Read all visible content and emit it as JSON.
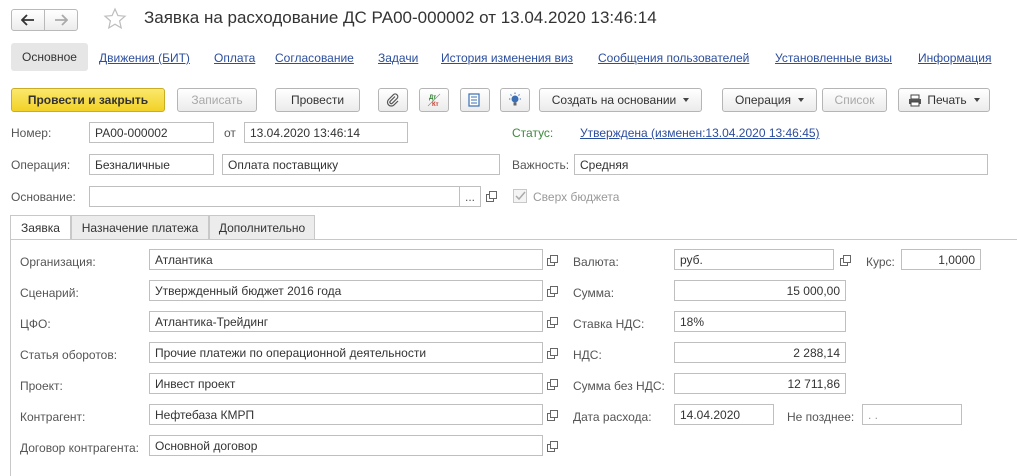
{
  "window": {
    "title": "Заявка на расходование ДС РА00-000002 от 13.04.2020 13:46:14"
  },
  "nav": {
    "back_icon": "arrow-left-icon",
    "forward_icon": "arrow-right-icon",
    "favorite_icon": "star-icon"
  },
  "tabs": [
    {
      "label": "Основное"
    },
    {
      "label": "Движения (БИТ)"
    },
    {
      "label": "Оплата"
    },
    {
      "label": "Согласование"
    },
    {
      "label": "Задачи"
    },
    {
      "label": "История изменения виз"
    },
    {
      "label": "Сообщения пользователей"
    },
    {
      "label": "Установленные визы"
    },
    {
      "label": "Информация"
    }
  ],
  "toolbar": {
    "post_close": "Провести и закрыть",
    "write": "Записать",
    "post": "Провести",
    "create_based_on": "Создать на основании",
    "operation": "Операция",
    "list": "Список",
    "print": "Печать",
    "icons": [
      "paperclip-icon",
      "dt-kt-icon",
      "structure-icon",
      "lightbulb-icon",
      "printer-icon"
    ]
  },
  "header": {
    "number_label": "Номер:",
    "number_value": "РА00-000002",
    "from_label": "от",
    "date_value": "13.04.2020 13:46:14",
    "status_label": "Статус:",
    "status_value": "Утверждена (изменен:13.04.2020 13:46:45)",
    "operation_label": "Операция:",
    "operation_type": "Безналичные",
    "operation_value": "Оплата поставщику",
    "importance_label": "Важность:",
    "importance_value": "Средняя",
    "basis_label": "Основание:",
    "basis_value": "",
    "basis_dots": "...",
    "over_budget_label": "Сверх бюджета",
    "over_budget_checked": true
  },
  "page_tabs": [
    {
      "label": "Заявка"
    },
    {
      "label": "Назначение платежа"
    },
    {
      "label": "Дополнительно"
    }
  ],
  "form": {
    "organization_label": "Организация:",
    "organization": "Атлантика",
    "scenario_label": "Сценарий:",
    "scenario": "Утвержденный бюджет 2016  года",
    "cfo_label": "ЦФО:",
    "cfo": "Атлантика-Трейдинг",
    "turnover_label": "Статья оборотов:",
    "turnover": "Прочие платежи по операционной деятельности",
    "project_label": "Проект:",
    "project": "Инвест проект",
    "counterparty_label": "Контрагент:",
    "counterparty": "Нефтебаза КМРП",
    "contract_label": "Договор контрагента:",
    "contract": "Основной договор",
    "currency_label": "Валюта:",
    "currency": "руб.",
    "rate_label": "Курс:",
    "rate": "1,0000",
    "amount_label": "Сумма:",
    "amount": "15 000,00",
    "vat_rate_label": "Ставка НДС:",
    "vat_rate": "18%",
    "vat_label": "НДС:",
    "vat": "2 288,14",
    "amount_no_vat_label": "Сумма без НДС:",
    "amount_no_vat": "12 711,86",
    "expense_date_label": "Дата расхода:",
    "expense_date": "14.04.2020",
    "not_later_label": "Не позднее:",
    "not_later": " .  ."
  },
  "colors": {
    "link": "#2c4e9e",
    "primary_button": "#f2d227",
    "status_label": "#3d8a3d"
  }
}
